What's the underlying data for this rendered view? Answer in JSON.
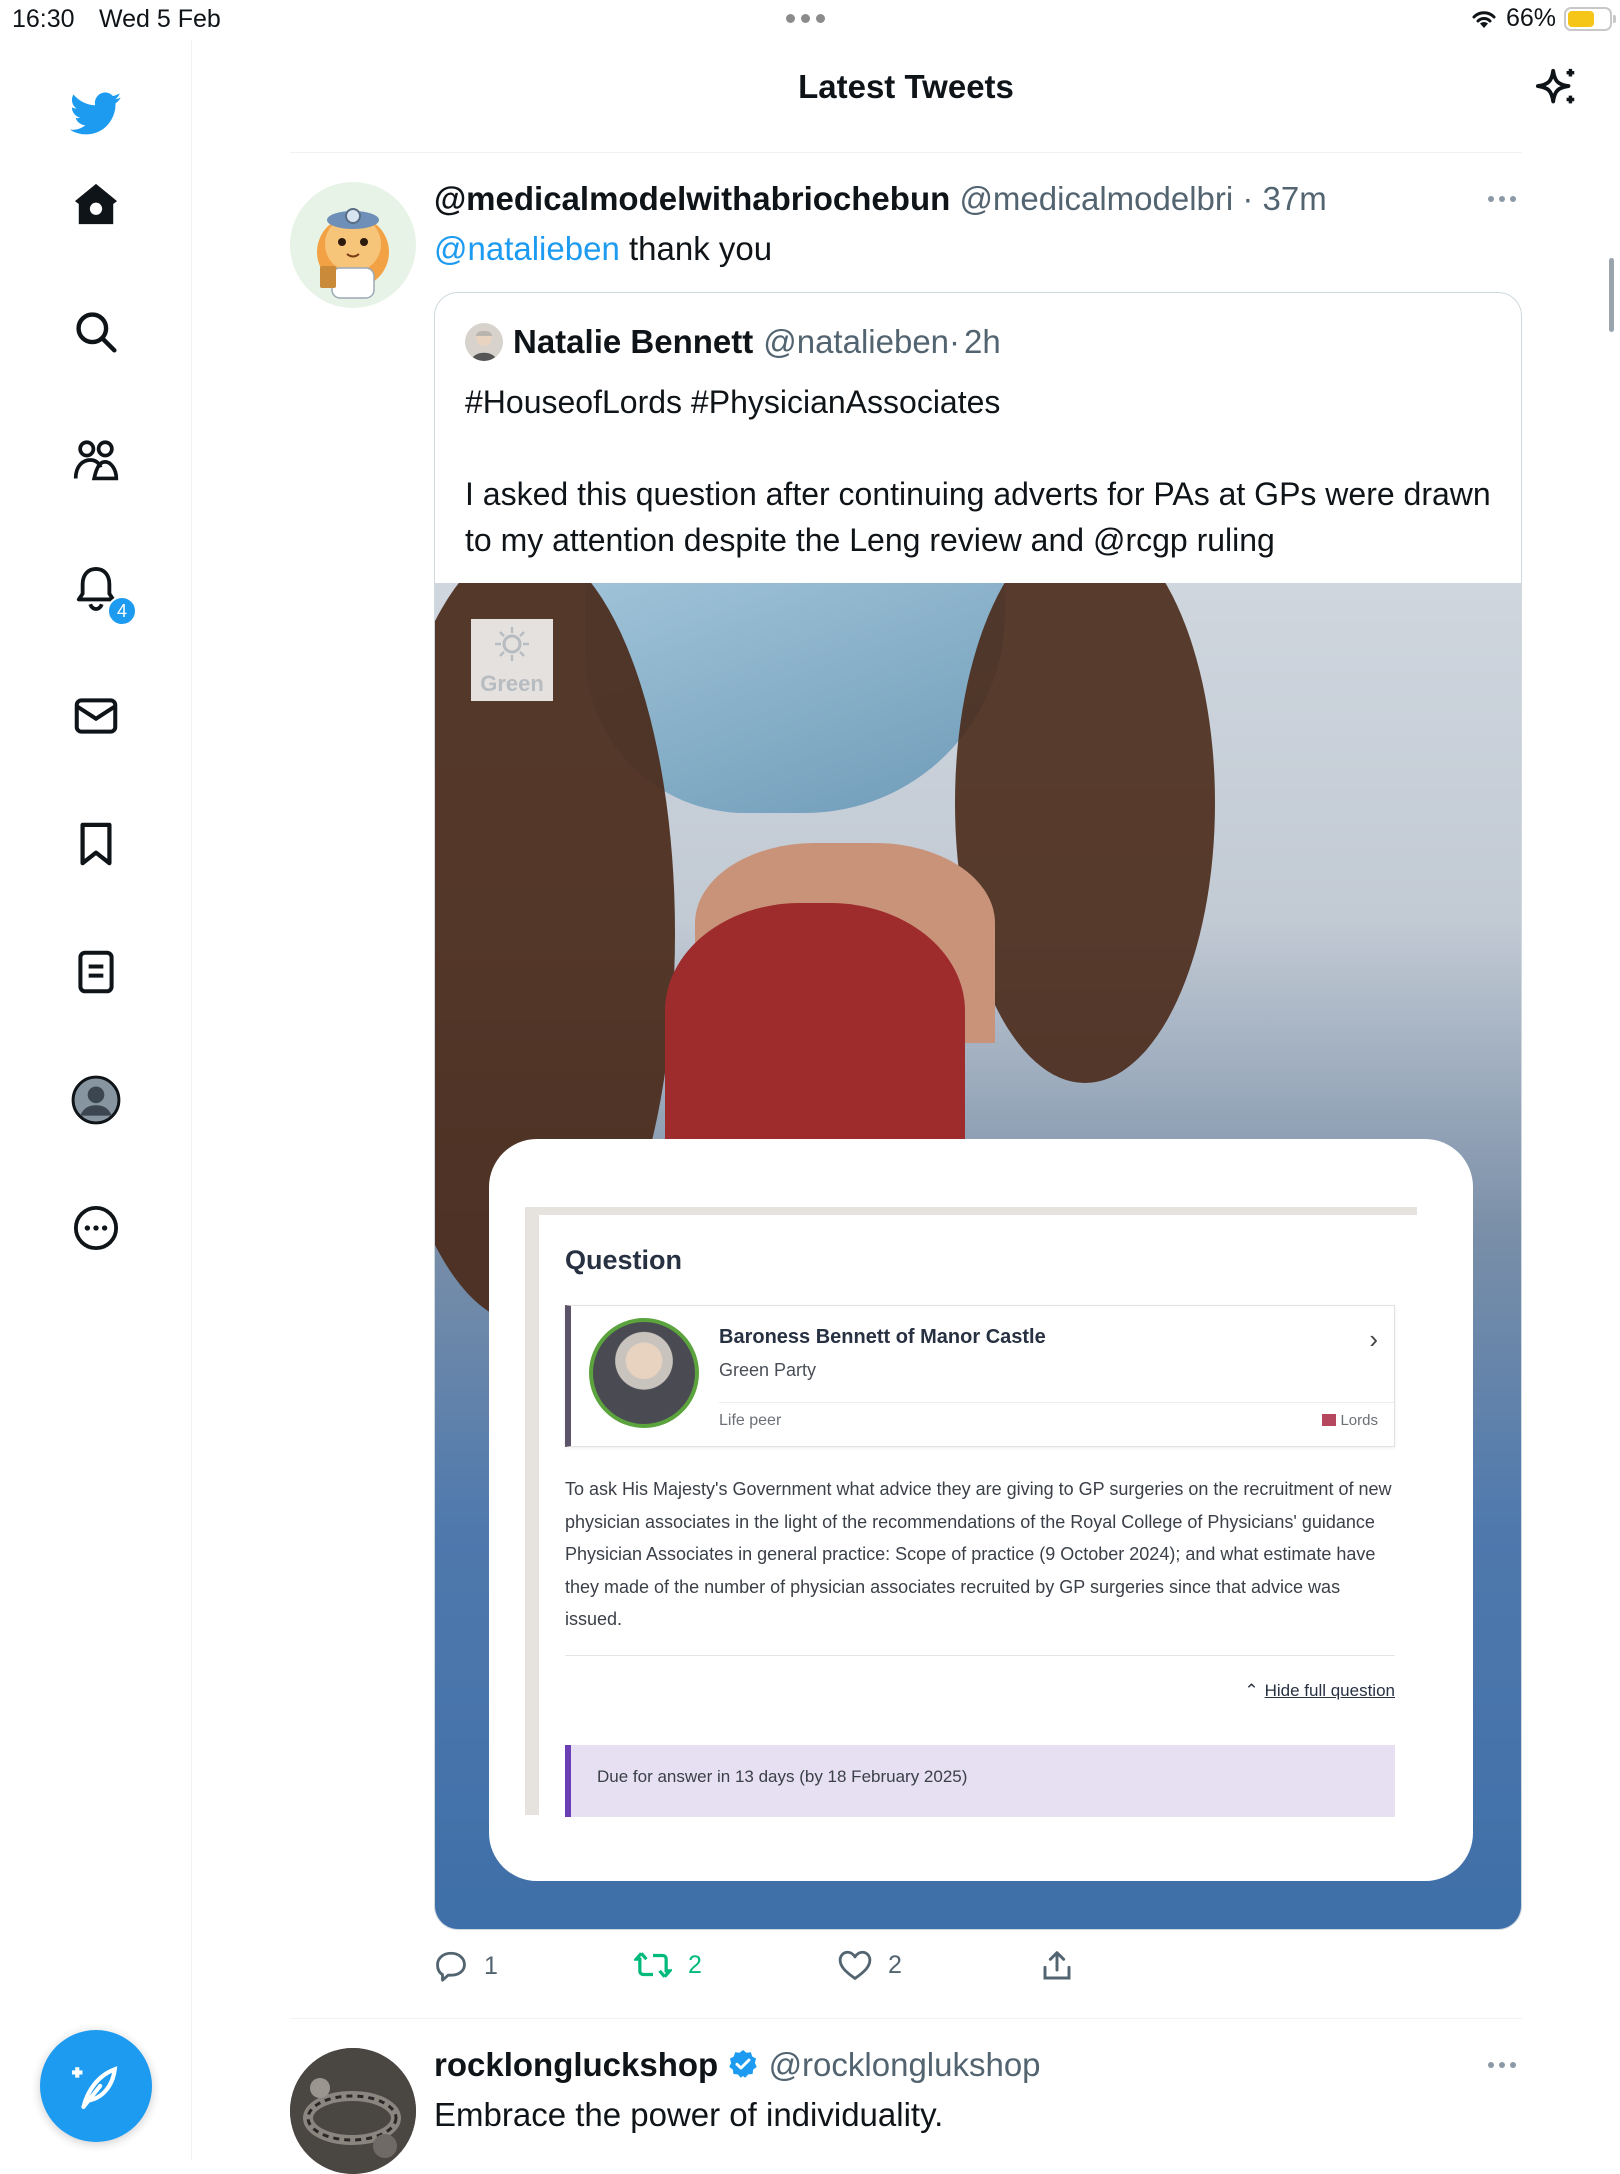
{
  "status": {
    "time": "16:30",
    "date": "Wed 5 Feb",
    "battery": "66%",
    "battery_level": 0.66
  },
  "header": {
    "title": "Latest Tweets"
  },
  "sidebar": {
    "notifications_badge": "4"
  },
  "tweets": [
    {
      "name": "@medicalmodelwithabriochebun",
      "handle": "@medicalmodelbri",
      "time": "37m",
      "mention": "@natalieben",
      "text": " thank you",
      "quote": {
        "name": "Natalie Bennett",
        "handle": "@natalieben",
        "time": "2h",
        "line1": "#HouseofLords #PhysicianAssociates",
        "line2": "I asked this question after continuing adverts for PAs at GPs were drawn to my attention despite the Leng review and @rcgp ruling",
        "image": {
          "watermark": "Green",
          "card_title": "Question",
          "member_name": "Baroness Bennett of Manor Castle",
          "member_party": "Green Party",
          "member_type": "Life peer",
          "house": "Lords",
          "question": "To ask His Majesty's Government what advice they are giving to GP surgeries on the recruitment of new physician associates in the light of the recommendations of the Royal College of Physicians' guidance Physician Associates in general practice: Scope of practice (9 October 2024); and what estimate have they made of the number of physician associates recruited by GP surgeries since that advice was issued.",
          "hide_link": "Hide full question",
          "due": "Due for answer in 13 days (by 18 February 2025)"
        }
      },
      "replies": "1",
      "retweets": "2",
      "likes": "2"
    },
    {
      "name": "rocklongluckshop",
      "handle": "@rocklonglukshop",
      "text": "Embrace the power of individuality."
    }
  ],
  "colors": {
    "accent": "#1d9bf0",
    "retweet": "#00ba7c",
    "muted": "#536471"
  }
}
